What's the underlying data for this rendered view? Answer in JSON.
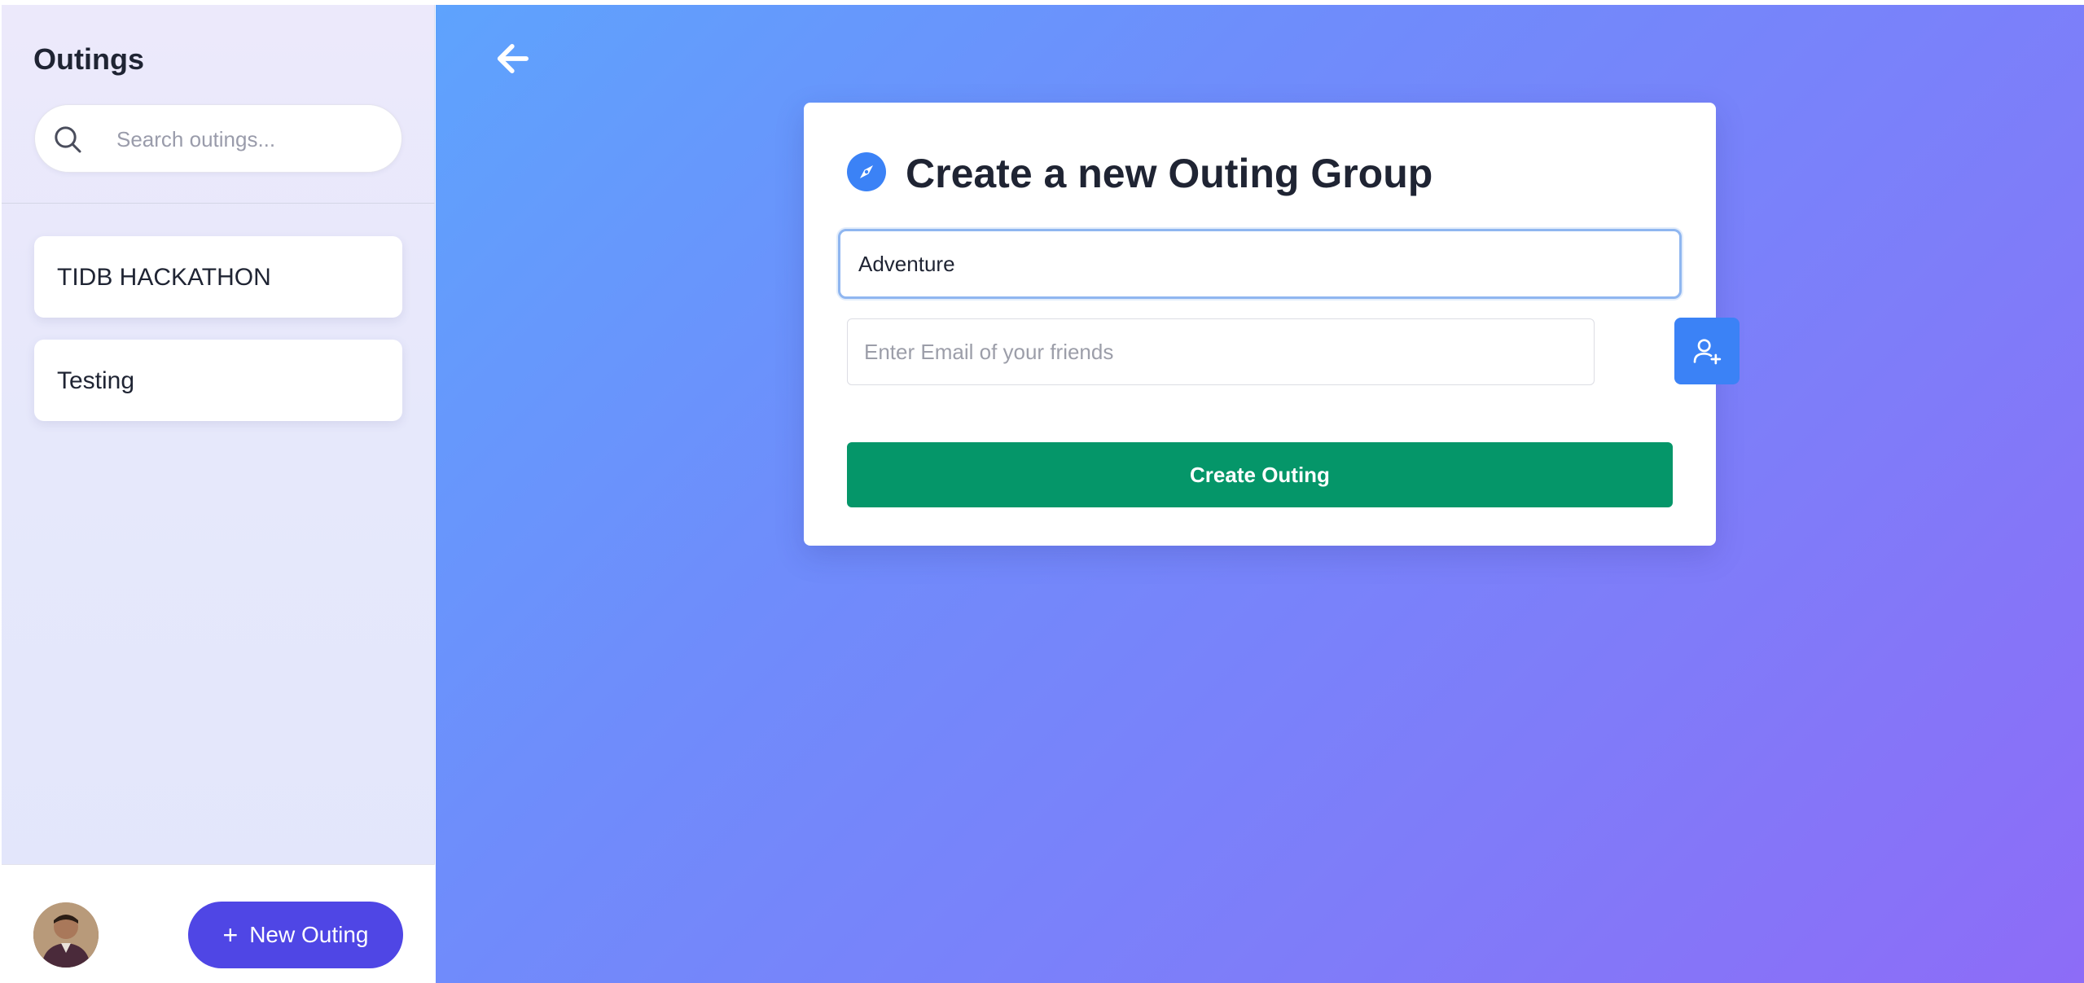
{
  "sidebar": {
    "title": "Outings",
    "search": {
      "placeholder": "Search outings...",
      "value": ""
    },
    "items": [
      {
        "label": "TIDB HACKATHON"
      },
      {
        "label": "Testing"
      }
    ],
    "new_outing_label": "New Outing"
  },
  "main": {
    "card": {
      "title": "Create a new Outing Group",
      "name_value": "Adventure",
      "email_placeholder": "Enter Email of your friends",
      "create_label": "Create Outing"
    }
  },
  "colors": {
    "primary_indigo": "#4f46e5",
    "add_friend_blue": "#3b82f6",
    "create_green": "#059669",
    "gradient_start": "#5ea3fd",
    "gradient_end": "#8d6cf7"
  },
  "icons": {
    "back": "arrow-left-icon",
    "search": "search-icon",
    "compass": "compass-icon",
    "add_user": "user-plus-icon",
    "plus": "plus-icon"
  }
}
